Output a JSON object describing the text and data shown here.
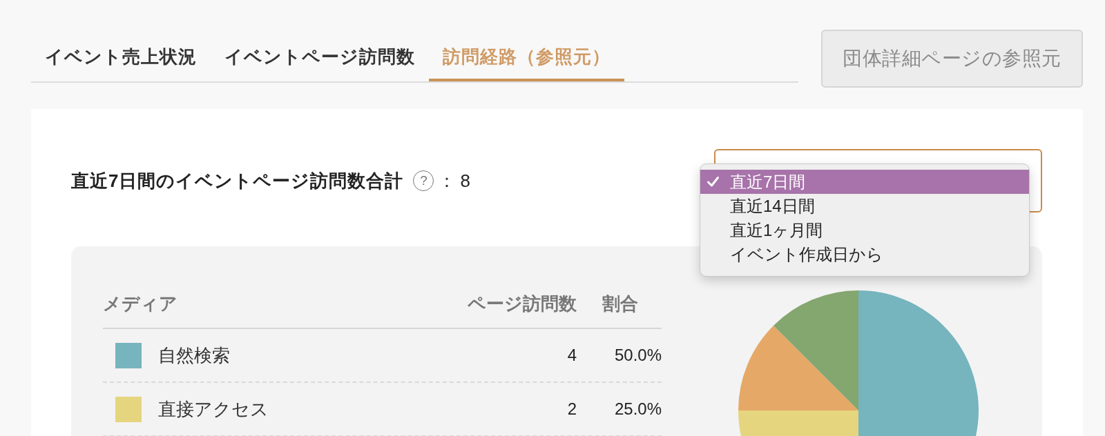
{
  "tabs": [
    {
      "label": "イベント売上状況",
      "selected": false
    },
    {
      "label": "イベントページ訪問数",
      "selected": false
    },
    {
      "label": "訪問経路（参照元）",
      "selected": true
    }
  ],
  "referrer_button": {
    "label": "団体詳細ページの参照元"
  },
  "summary": {
    "label": "直近7日間のイベントページ訪問数合計",
    "help": "?",
    "separator": "：",
    "total": "8"
  },
  "period_select": {
    "expanded": true,
    "options": [
      {
        "label": "直近7日間",
        "selected": true
      },
      {
        "label": "直近14日間",
        "selected": false
      },
      {
        "label": "直近1ヶ月間",
        "selected": false
      },
      {
        "label": "イベント作成日から",
        "selected": false
      }
    ]
  },
  "table": {
    "columns": [
      "メディア",
      "ページ訪問数",
      "割合"
    ],
    "rows": [
      {
        "media": "自然検索",
        "color": "#76b4be",
        "visits": "4",
        "share": "50.0%"
      },
      {
        "media": "直接アクセス",
        "color": "#e5d57f",
        "visits": "2",
        "share": "25.0%"
      }
    ]
  }
}
